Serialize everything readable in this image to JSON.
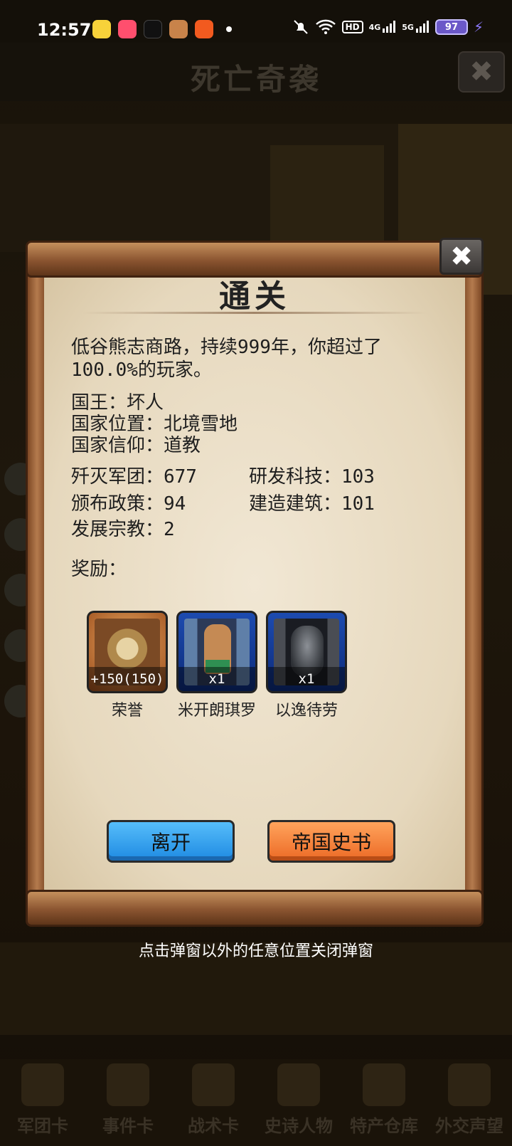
{
  "status_bar": {
    "time": "12:57",
    "battery": "97",
    "network_1": "4G",
    "network_2": "5G",
    "hd": "HD"
  },
  "background": {
    "title": "死亡奇袭",
    "nav": [
      "军团卡",
      "事件卡",
      "战术卡",
      "史诗人物",
      "特产仓库",
      "外交声望"
    ]
  },
  "dialog": {
    "title": "通关",
    "description": "低谷熊志商路，持续999年，你超过了100.0%的玩家。",
    "king": "国王：坏人",
    "location": "国家位置：北境雪地",
    "religion": "国家信仰：道教",
    "stats": {
      "legions": "歼灭军团：677",
      "tech": "研发科技：103",
      "policies": "颁布政策：94",
      "buildings": "建造建筑：101",
      "religions": "发展宗教：2"
    },
    "rewards_label": "奖励：",
    "rewards": [
      {
        "name": "荣誉",
        "count": "+150(150)"
      },
      {
        "name": "米开朗琪罗",
        "count": "x1"
      },
      {
        "name": "以逸待劳",
        "count": "x1"
      }
    ],
    "leave_button": "离开",
    "history_button": "帝国史书"
  },
  "hint": "点击弹窗以外的任意位置关闭弹窗"
}
